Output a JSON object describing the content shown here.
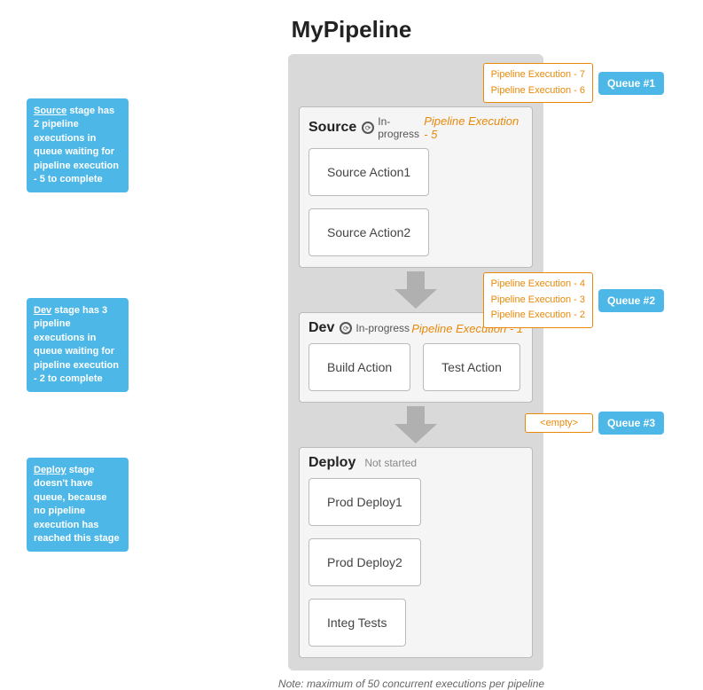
{
  "page": {
    "title": "MyPipeline"
  },
  "annotations": {
    "source": {
      "bold": "Source",
      "text": " stage has 2 pipeline executions in queue waiting for pipeline execution - 5 to complete"
    },
    "dev": {
      "bold": "Dev",
      "text": " stage has 3 pipeline executions in queue waiting for pipeline execution - 2 to complete"
    },
    "deploy": {
      "bold": "Deploy",
      "text": " stage doesn't have queue, because no pipeline execution has reached this stage"
    }
  },
  "queues": {
    "queue1": {
      "label": "Queue #1",
      "executions": [
        "Pipeline Execution - 7",
        "Pipeline Execution - 6"
      ]
    },
    "queue2": {
      "label": "Queue #2",
      "executions": [
        "Pipeline Execution - 4",
        "Pipeline Execution - 3",
        "Pipeline Execution - 2"
      ]
    },
    "queue3": {
      "label": "Queue #3",
      "executions": [
        "<empty>"
      ]
    }
  },
  "stages": {
    "source": {
      "name": "Source",
      "status": "In-progress",
      "execution": "Pipeline Execution  - 5",
      "actions": [
        "Source Action1",
        "Source Action2"
      ]
    },
    "dev": {
      "name": "Dev",
      "status": "In-progress",
      "execution": "Pipeline Execution  - 1",
      "actions": [
        "Build Action",
        "Test Action"
      ]
    },
    "deploy": {
      "name": "Deploy",
      "status": "Not started",
      "execution": "",
      "actions": [
        "Prod Deploy1",
        "Prod Deploy2",
        "Integ Tests"
      ]
    }
  },
  "note": "Note:  maximum of 50 concurrent executions  per pipeline"
}
